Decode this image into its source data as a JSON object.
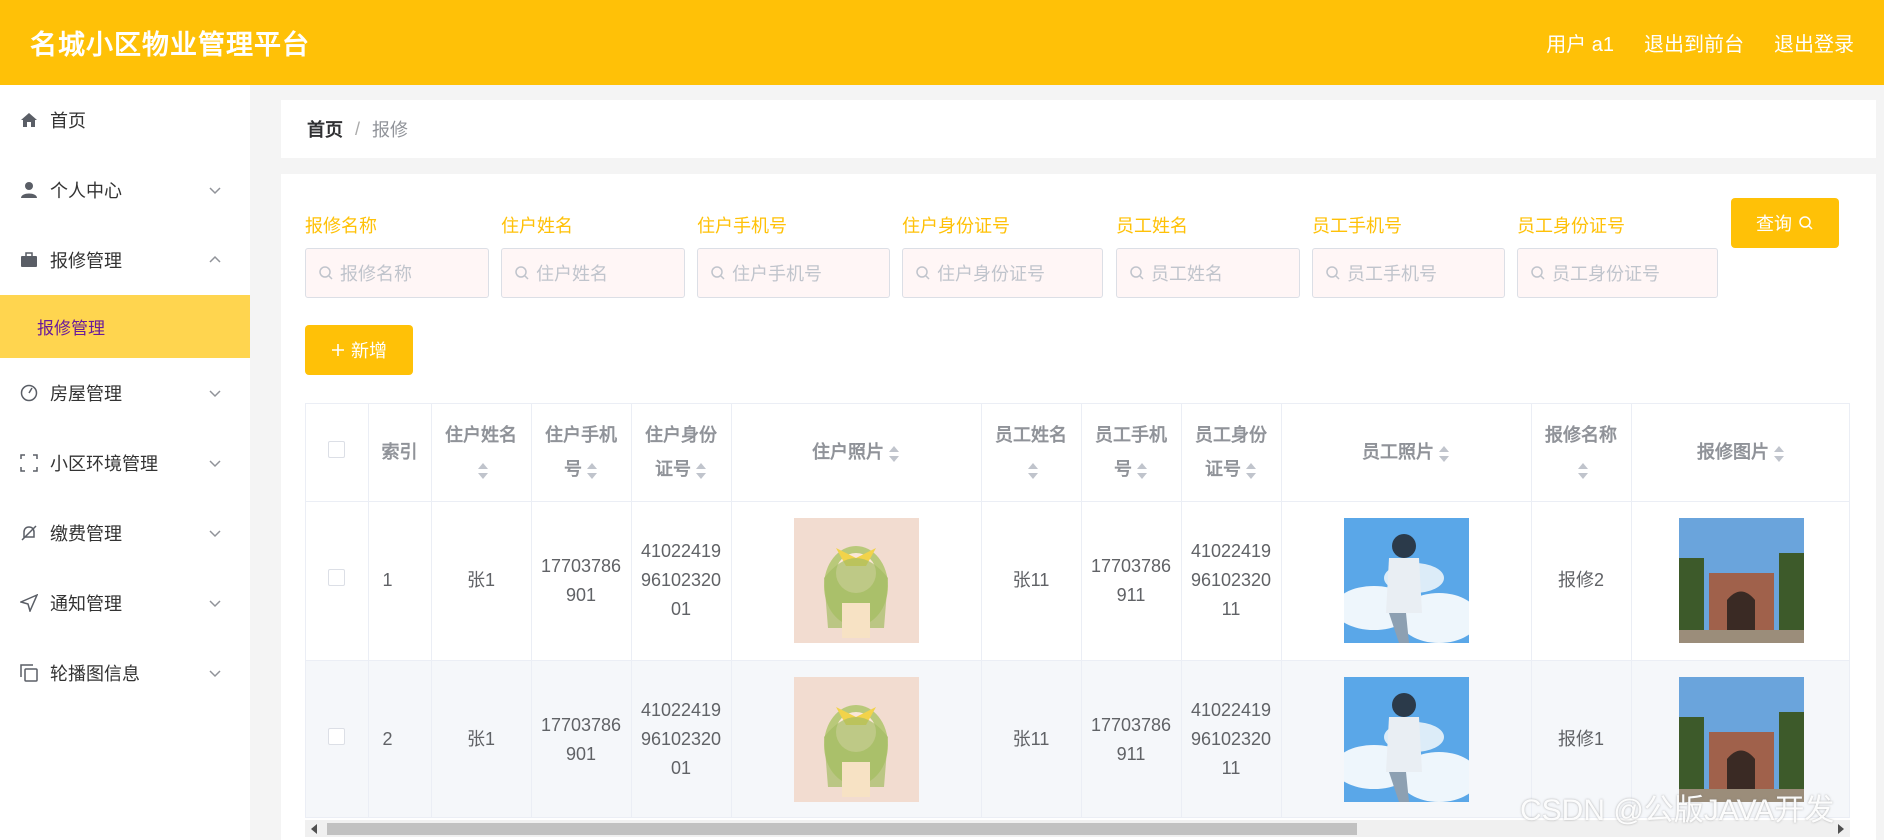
{
  "header": {
    "title": "名城小区物业管理平台",
    "links": [
      "用户 a1",
      "退出到前台",
      "退出登录"
    ]
  },
  "sidebar": {
    "items": [
      {
        "label": "首页",
        "icon": "home-icon"
      },
      {
        "label": "个人中心",
        "icon": "user-icon"
      },
      {
        "label": "报修管理",
        "icon": "briefcase-icon"
      },
      {
        "label": "房屋管理",
        "icon": "gauge-icon"
      },
      {
        "label": "小区环境管理",
        "icon": "fullscreen-icon"
      },
      {
        "label": "缴费管理",
        "icon": "bell-off-icon"
      },
      {
        "label": "通知管理",
        "icon": "send-icon"
      },
      {
        "label": "轮播图信息",
        "icon": "copy-icon"
      }
    ],
    "submenu": {
      "label": "报修管理"
    }
  },
  "breadcrumb": {
    "home": "首页",
    "separator": "/",
    "current": "报修"
  },
  "search": {
    "fields": [
      {
        "label": "报修名称",
        "placeholder": "报修名称"
      },
      {
        "label": "住户姓名",
        "placeholder": "住户姓名"
      },
      {
        "label": "住户手机号",
        "placeholder": "住户手机号"
      },
      {
        "label": "住户身份证号",
        "placeholder": "住户身份证号"
      },
      {
        "label": "员工姓名",
        "placeholder": "员工姓名"
      },
      {
        "label": "员工手机号",
        "placeholder": "员工手机号"
      },
      {
        "label": "员工身份证号",
        "placeholder": "员工身份证号"
      }
    ],
    "query_label": "查询",
    "add_label": "新增"
  },
  "table": {
    "headers": [
      "索引",
      "住户姓名",
      "住户手机号",
      "住户身份证号",
      "住户照片",
      "员工姓名",
      "员工手机号",
      "员工身份证号",
      "员工照片",
      "报修名称",
      "报修图片"
    ],
    "rows": [
      {
        "index": "1",
        "resident_name": "张1",
        "resident_phone": "17703786901",
        "resident_id": "410224199610232001",
        "staff_name": "张11",
        "staff_phone": "17703786911",
        "staff_id": "410224199610232011",
        "repair_name": "报修2"
      },
      {
        "index": "2",
        "resident_name": "张1",
        "resident_phone": "17703786901",
        "resident_id": "410224199610232001",
        "staff_name": "张11",
        "staff_phone": "17703786911",
        "staff_id": "410224199610232011",
        "repair_name": "报修1"
      }
    ]
  },
  "watermark": "CSDN @公版JAVA开发",
  "colors": {
    "accent": "#ffc107",
    "submenu_bg": "#ffd54f",
    "submenu_text": "#6a1b9a"
  }
}
